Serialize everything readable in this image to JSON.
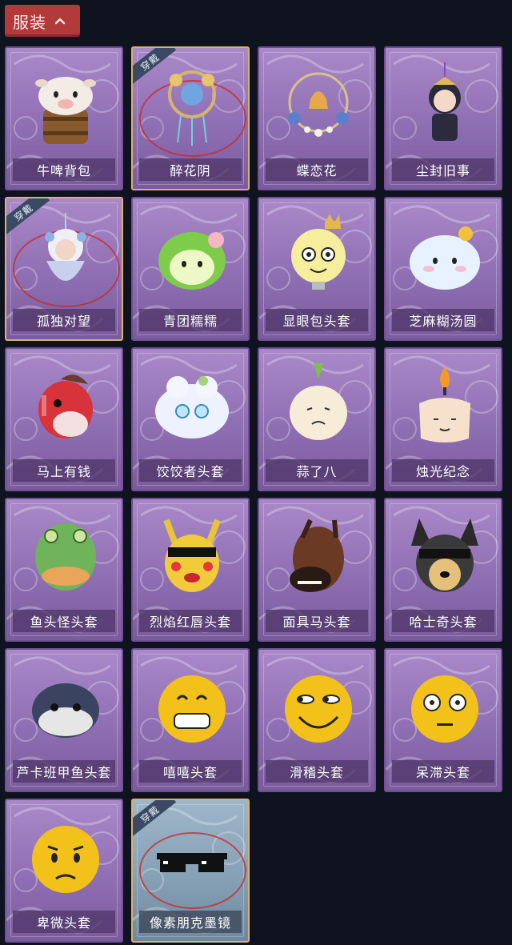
{
  "header": {
    "tab_label": "服装",
    "tab_icon": "chevron-up-icon"
  },
  "colors": {
    "background": "#0f1320",
    "tab_red": "#b23a3a",
    "card_purple": "#a989c8",
    "card_silver": "#9fb6c9",
    "equipped_gold": "#d6b46a"
  },
  "equipped_badge": "穿戴",
  "items": [
    {
      "name": "牛啤背包",
      "icon": "cow-beer-backpack-icon",
      "equipped": false
    },
    {
      "name": "醉花阴",
      "icon": "flower-dreamcatcher-icon",
      "equipped": true
    },
    {
      "name": "蝶恋花",
      "icon": "butterfly-bell-wreath-icon",
      "equipped": false
    },
    {
      "name": "尘封旧事",
      "icon": "chibi-figure-charm-icon",
      "equipped": false
    },
    {
      "name": "孤独对望",
      "icon": "white-haired-doll-charm-icon",
      "equipped": true
    },
    {
      "name": "青团糯糯",
      "icon": "green-rice-ball-icon",
      "equipped": false
    },
    {
      "name": "显眼包头套",
      "icon": "crowned-lightbulb-head-icon",
      "equipped": false
    },
    {
      "name": "芝麻糊汤圆",
      "icon": "white-dumpling-head-icon",
      "equipped": false
    },
    {
      "name": "马上有钱",
      "icon": "red-horse-head-icon",
      "equipped": false
    },
    {
      "name": "饺饺者头套",
      "icon": "dumpling-head-icon",
      "equipped": false
    },
    {
      "name": "蒜了八",
      "icon": "garlic-head-icon",
      "equipped": false
    },
    {
      "name": "烛光纪念",
      "icon": "candle-head-icon",
      "equipped": false
    },
    {
      "name": "鱼头怪头套",
      "icon": "fish-head-mask-icon",
      "equipped": false
    },
    {
      "name": "烈焰红唇头套",
      "icon": "yellow-mask-sunglasses-icon",
      "equipped": false
    },
    {
      "name": "面具马头套",
      "icon": "horse-mask-icon",
      "equipped": false
    },
    {
      "name": "哈士奇头套",
      "icon": "husky-head-sunglasses-icon",
      "equipped": false
    },
    {
      "name": "芦卡班甲鱼头套",
      "icon": "fish-head-icon",
      "equipped": false
    },
    {
      "name": "嘻嘻头套",
      "icon": "grinning-emoji-head-icon",
      "equipped": false
    },
    {
      "name": "滑稽头套",
      "icon": "funny-emoji-head-icon",
      "equipped": false
    },
    {
      "name": "呆滞头套",
      "icon": "dazed-emoji-head-icon",
      "equipped": false
    },
    {
      "name": "卑微头套",
      "icon": "humble-emoji-head-icon",
      "equipped": false
    },
    {
      "name": "像素朋克墨镜",
      "icon": "pixel-sunglasses-icon",
      "equipped": true,
      "silver": true
    }
  ]
}
